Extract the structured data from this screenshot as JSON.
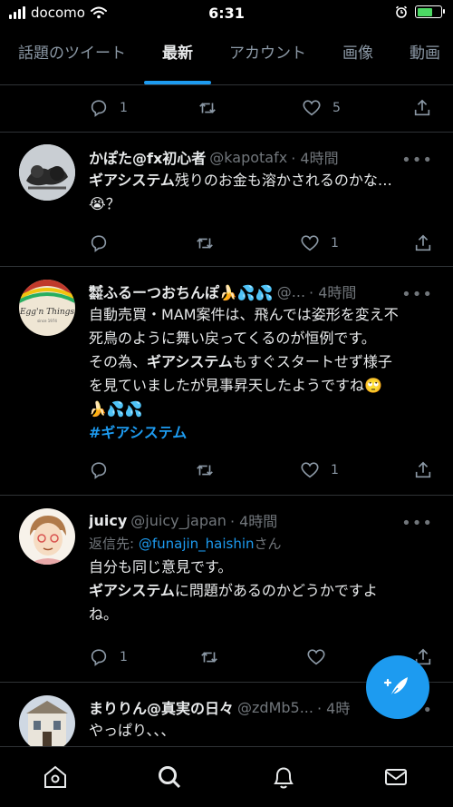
{
  "status_bar": {
    "carrier": "docomo",
    "time": "6:31",
    "battery_level": 0.65
  },
  "tabs": [
    {
      "label": "話題のツイート",
      "active": false
    },
    {
      "label": "最新",
      "active": true
    },
    {
      "label": "アカウント",
      "active": false
    },
    {
      "label": "画像",
      "active": false
    },
    {
      "label": "動画",
      "active": false
    }
  ],
  "top_actions": {
    "replies": "1",
    "retweets": "",
    "likes": "5"
  },
  "tweets": [
    {
      "name": "かぽた@fx初心者",
      "handle": "@kapotafx",
      "time": "· 4時間",
      "text_bold": "ギアシステム",
      "text_rest": "残りのお金も溶かされるのかな…",
      "text_line2": "😭？",
      "replies": "",
      "retweets": "",
      "likes": "1"
    },
    {
      "name": "㍿ふるーつおちんぽ🍌💦💦",
      "handle": "@...",
      "time": "· 4時間",
      "line1": "自動売買・MAM案件は、飛んでは姿形を変え不",
      "line2": "死鳥のように舞い戻ってくるのが恒例です。",
      "line3_pre": "その為、",
      "line3_bold": "ギアシステム",
      "line3_post": "もすぐスタートせず様子",
      "line4": "を見ていましたが見事昇天したようですね🙄",
      "line5": "🍌💦💦",
      "hashtag": "#ギアシステム",
      "replies": "",
      "retweets": "",
      "likes": "1"
    },
    {
      "name": "juicy",
      "handle": "@juicy_japan",
      "time": "· 4時間",
      "reply_prefix": "返信先: ",
      "reply_mention": "@funajin_haishin",
      "reply_suffix": "さん",
      "line1": "自分も同じ意見です。",
      "line2_bold": "ギアシステム",
      "line2_rest": "に問題があるのかどうかですよ",
      "line3": "ね。",
      "replies": "1",
      "retweets": "",
      "likes": ""
    },
    {
      "name": "まりりん@真実の日々",
      "handle": "@zdMb5...",
      "time": "· 4時",
      "line1": "やっぱり、、、"
    }
  ],
  "icons": {
    "reply": "reply-icon",
    "retweet": "retweet-icon",
    "like": "heart-icon",
    "share": "share-icon",
    "compose": "compose-tweet-icon"
  },
  "colors": {
    "accent": "#1d9bf0",
    "background": "#000000",
    "text": "#e7e9ea",
    "muted": "#71767b"
  }
}
